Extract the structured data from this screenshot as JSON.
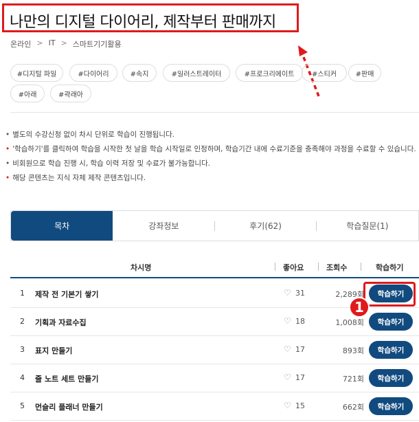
{
  "title": "나만의 디지털 다이어리, 제작부터 판매까지",
  "breadcrumb": [
    "온라인",
    "IT",
    "스마트기기활용"
  ],
  "tags": [
    "#디지털 파일",
    "#다이어리",
    "#속지",
    "#일러스트레이터",
    "#프로크리에이트",
    "#스티커",
    "#판매",
    "#아래",
    "#곽래아"
  ],
  "notes": [
    {
      "text": "별도의 수강신청 없이 차시 단위로 학습이 진행됩니다.",
      "accent": false
    },
    {
      "text": "'학습하기'를 클릭하여 학습을 시작한 첫 날을 학습 시작일로 인정하며, 학습기간 내에 수료기준을 충족해야 과정을 수료할 수 있습니다.",
      "accent": true
    },
    {
      "text": "비회원으로 학습 진행 시, 학습 이력 저장 및 수료가 불가능합니다.",
      "accent": false
    },
    {
      "text": "해당 콘텐츠는 지식 자체 제작 콘텐츠입니다.",
      "accent": true
    }
  ],
  "tabs": [
    "목차",
    "강좌정보",
    "후기(62)",
    "학습질문(1)"
  ],
  "table": {
    "headers": {
      "name": "차시명",
      "likes": "좋아요",
      "views": "조회수",
      "action": "학습하기"
    },
    "rows": [
      {
        "num": "1",
        "name": "제작 전 기본기 쌓기",
        "likes": "31",
        "views": "2,289회",
        "btn": "학습하기"
      },
      {
        "num": "2",
        "name": "기획과 자료수집",
        "likes": "18",
        "views": "1,008회",
        "btn": "학습하기"
      },
      {
        "num": "3",
        "name": "표지 만들기",
        "likes": "17",
        "views": "893회",
        "btn": "학습하기"
      },
      {
        "num": "4",
        "name": "줄 노트 세트 만들기",
        "likes": "17",
        "views": "721회",
        "btn": "학습하기"
      },
      {
        "num": "5",
        "name": "먼슬리 플래너 만들기",
        "likes": "15",
        "views": "662회",
        "btn": "학습하기"
      }
    ]
  },
  "annotation": {
    "badge": "1"
  },
  "colors": {
    "accent_red": "#e0191c",
    "primary_blue": "#114a7f"
  }
}
